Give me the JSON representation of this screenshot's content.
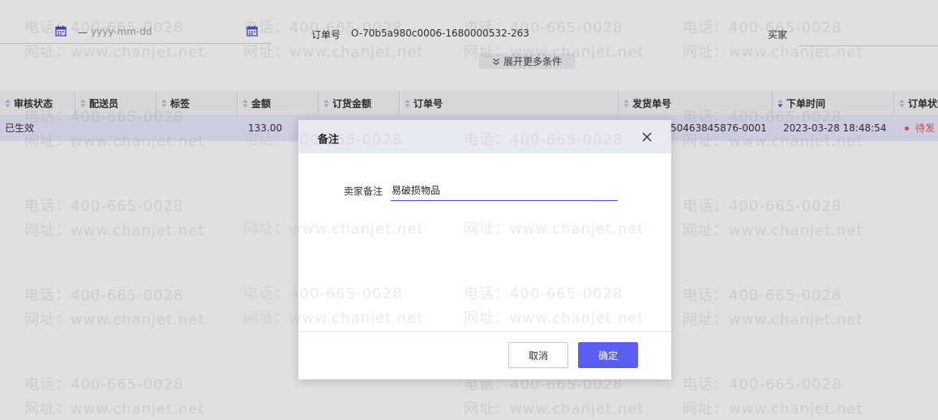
{
  "filters": {
    "date_separator": "—",
    "date_end_placeholder": "yyyy-mm-dd",
    "order_label": "订单号",
    "order_value": "O-70b5a980c0006-1680000532-263",
    "buyer_label": "买家",
    "expand_label": "展开更多条件"
  },
  "table": {
    "columns": [
      "审核状态",
      "配送员",
      "标签",
      "金额",
      "订货金额",
      "订单号",
      "发货单号",
      "下单时间",
      "订单状态"
    ],
    "row": {
      "audit_status": "已生效",
      "amount": "133.00",
      "shipment_no": "50463845876-0001",
      "order_time": "2023-03-28 18:48:54",
      "order_status": "待发"
    }
  },
  "watermark": {
    "phone": "电话：400-665-0028",
    "site": "网址：www.chanjet.net"
  },
  "modal": {
    "title": "备注",
    "field_label": "卖家备注",
    "field_value": "易破损物品",
    "cancel_label": "取消",
    "ok_label": "确定"
  },
  "colors": {
    "accent": "#5a5ef5",
    "icon_blue": "#3b4bd8",
    "selected_row": "#e9eaff",
    "status_red": "#e05b5b"
  }
}
